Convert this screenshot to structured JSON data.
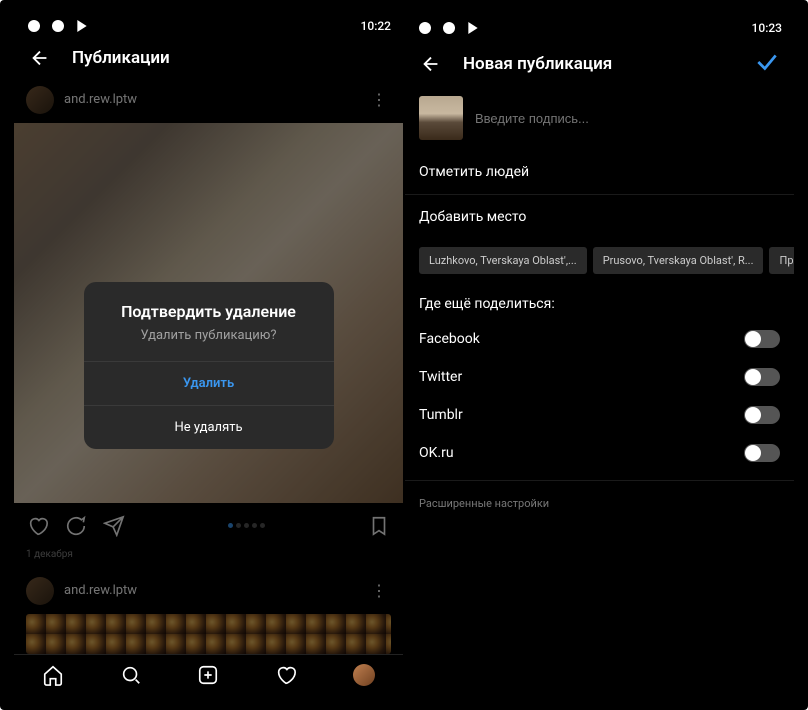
{
  "left": {
    "status_time": "10:22",
    "header_title": "Публикации",
    "username": "and.rew.lptw",
    "modal": {
      "title": "Подтвердить удаление",
      "subtitle": "Удалить публикацию?",
      "delete": "Удалить",
      "cancel": "Не удалять"
    },
    "post_date": "1 декабря",
    "username2": "and.rew.lptw"
  },
  "right": {
    "status_time": "10:23",
    "header_title": "Новая публикация",
    "caption_placeholder": "Введите подпись...",
    "tag_people": "Отметить людей",
    "add_location": "Добавить место",
    "chips": [
      "Luzhkovo, Tverskaya Oblast',...",
      "Prusovo, Tverskaya Oblast', R...",
      "Прямух..."
    ],
    "share_title": "Где ещё поделиться:",
    "networks": [
      {
        "name": "Facebook"
      },
      {
        "name": "Twitter"
      },
      {
        "name": "Tumblr"
      },
      {
        "name": "OK.ru"
      }
    ],
    "advanced": "Расширенные настройки"
  }
}
